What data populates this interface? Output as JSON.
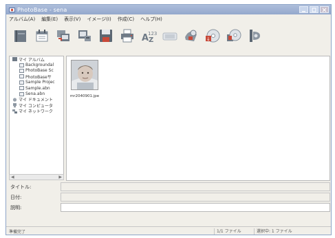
{
  "window": {
    "title": "PhotoBase - sena"
  },
  "menu": [
    {
      "label": "アルバム(A)"
    },
    {
      "label": "編集(E)"
    },
    {
      "label": "表示(V)"
    },
    {
      "label": "イメージ(I)"
    },
    {
      "label": "作成(C)"
    },
    {
      "label": "ヘルプ(H)"
    }
  ],
  "toolbar": [
    {
      "icon": "album-icon"
    },
    {
      "icon": "calendar-icon"
    },
    {
      "icon": "import-icon"
    },
    {
      "icon": "export-icon"
    },
    {
      "icon": "save-icon"
    },
    {
      "icon": "print-icon"
    },
    {
      "icon": "sort-icon"
    },
    {
      "icon": "slideshow-icon"
    },
    {
      "icon": "wallpaper-icon"
    },
    {
      "icon": "cd-icon"
    },
    {
      "icon": "cd-write-icon"
    },
    {
      "icon": "video-icon"
    }
  ],
  "tree": {
    "root": "マイ アルバム",
    "albums": [
      "Backgroundal",
      "PhotoBase Sc",
      "PhotoBaseサ",
      "Sample Projec",
      "Sample.abn",
      "Sena.abn"
    ],
    "others": [
      "マイ ドキュメント",
      "マイ コンピュータ",
      "マイ ネットワーク"
    ]
  },
  "thumbnail": {
    "filename": "mr2040901.jpe"
  },
  "properties": {
    "title_label": "タイトル:",
    "date_label": "日付:",
    "description_label": "説明:",
    "title_value": "",
    "date_value": "",
    "description_value": ""
  },
  "status": {
    "left": "準備完了",
    "cell1": "1/1 ファイル",
    "cell2": "選択中: 1 ファイル"
  },
  "colors": {
    "titlebar": "#93a8cc",
    "window_bg": "#f1efe9",
    "tool_red": "#c84a3a",
    "tool_gray": "#7d8894"
  }
}
